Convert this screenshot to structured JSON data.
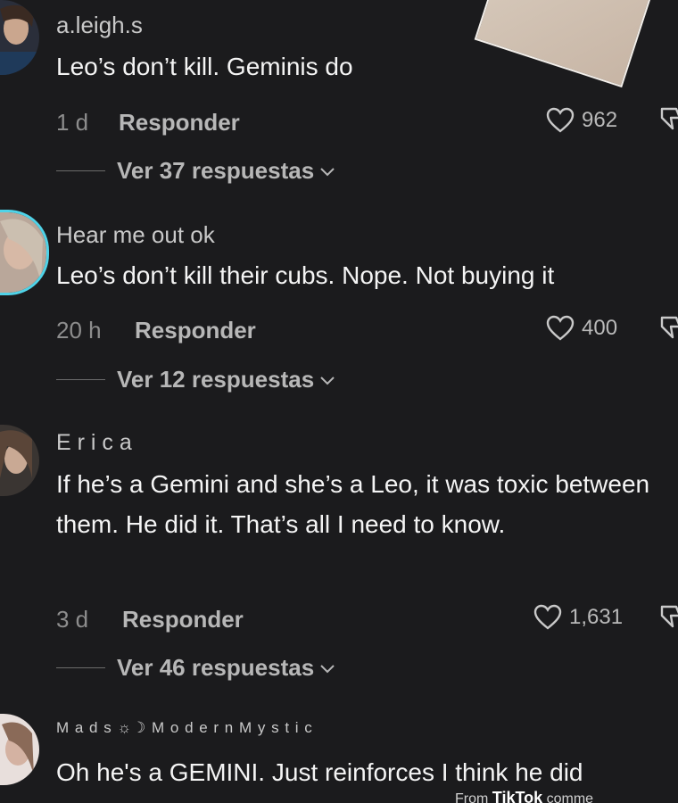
{
  "comments": [
    {
      "username": "a.leigh.s",
      "text": "Leo’s don’t kill. Geminis do",
      "time": "1 d",
      "reply_label": "Responder",
      "likes": "962",
      "view_replies": "Ver 37 respuestas"
    },
    {
      "username": "Hear me out ok",
      "text": "Leo’s don’t kill their cubs. Nope. Not buying it",
      "time": "20 h",
      "reply_label": "Responder",
      "likes": "400",
      "view_replies": "Ver 12 respuestas"
    },
    {
      "username": "E r i c a",
      "text": "If he’s a Gemini and she’s a Leo, it was toxic between them. He did it. That’s all I need to know.",
      "time": "3 d",
      "reply_label": "Responder",
      "likes": "1,631",
      "view_replies": "Ver 46 respuestas"
    },
    {
      "username": "M a d s  ☼☽  M o d e r n M y s t i c",
      "text": "Oh he's a GEMINI. Just reinforces I think he did"
    }
  ],
  "watermark": {
    "prefix": "From",
    "brand": "TikTok",
    "suffix": "comme"
  },
  "colors": {
    "background": "#1b1b1d",
    "avatar_ring": "#4fd3e8"
  },
  "icons": [
    "heart-icon",
    "dislike-icon",
    "chevron-down-icon"
  ]
}
